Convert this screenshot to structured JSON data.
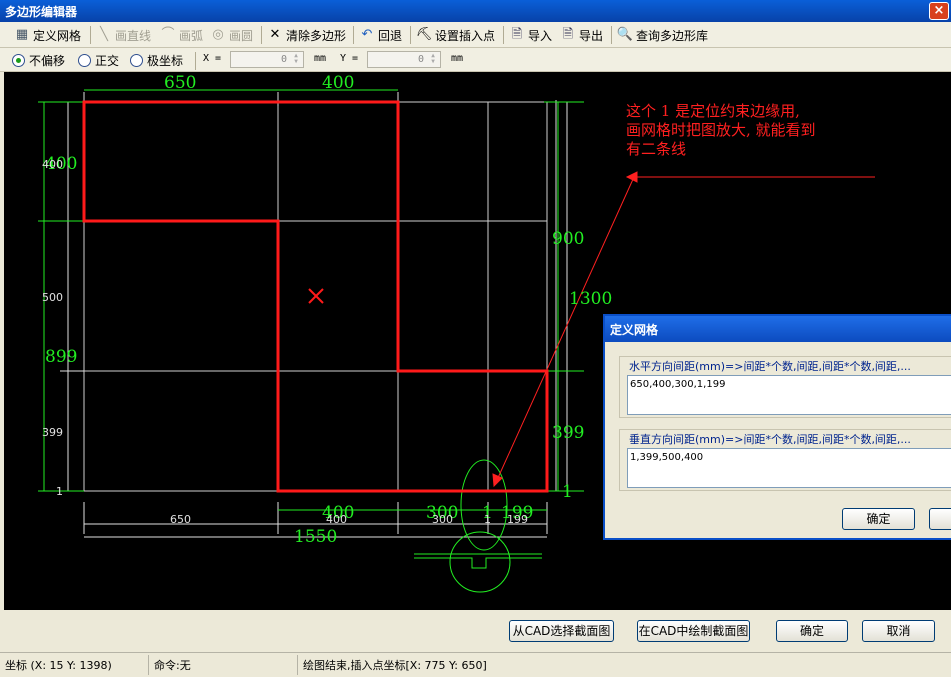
{
  "window": {
    "title": "多边形编辑器",
    "close": "×"
  },
  "toolbar": {
    "define_grid": "定义网格",
    "draw_line": "画直线",
    "draw_arc": "画弧",
    "draw_circle": "画圆",
    "clear_polygon": "清除多边形",
    "undo": "回退",
    "set_insert_point": "设置插入点",
    "import": "导入",
    "export": "导出",
    "query_library": "查询多边形库"
  },
  "options": {
    "no_offset": "不偏移",
    "orthogonal": "正交",
    "polar": "极坐标",
    "x_label": "X =",
    "x_value": "0",
    "x_unit": "mm",
    "y_label": "Y =",
    "y_value": "0",
    "y_unit": "mm"
  },
  "drawing": {
    "annotation": "这个 1 是定位约束边缘用,\n画网格时把图放大, 就能看到\n有二条线",
    "colors": {
      "polygon": "#ff1a1a",
      "dim_green": "#22ee22",
      "dim_white": "#e0e0e0",
      "grid": "#d0d0d0",
      "arrow": "#ff2020"
    },
    "top_dims": [
      "650",
      "400"
    ],
    "left_big_dims": [
      "400",
      "899"
    ],
    "left_small_dims": [
      "400",
      "500",
      "399",
      "1"
    ],
    "right_dims": [
      "900",
      "1300",
      "399",
      "1"
    ],
    "bottom_big_dims": [
      "400",
      "300",
      "1",
      "199"
    ],
    "bottom_small_dims": [
      "650",
      "400",
      "300",
      "1",
      "199"
    ],
    "total_width": "1550"
  },
  "dialog": {
    "title": "定义网格",
    "horiz_label": "水平方向间距(mm)=>间距*个数,间距,间距*个数,间距,...",
    "horiz_value": "650,400,300,1,199",
    "vert_label": "垂直方向间距(mm)=>间距*个数,间距,间距*个数,间距,...",
    "vert_value": "1,399,500,400",
    "ok": "确定"
  },
  "bottom": {
    "select_from_cad": "从CAD选择截面图",
    "draw_in_cad": "在CAD中绘制截面图",
    "ok": "确定",
    "cancel": "取消"
  },
  "status": {
    "coord": "坐标 (X: 15 Y: 1398)",
    "command": "命令:无",
    "message": "绘图结束,插入点坐标[X: 775 Y: 650]"
  }
}
